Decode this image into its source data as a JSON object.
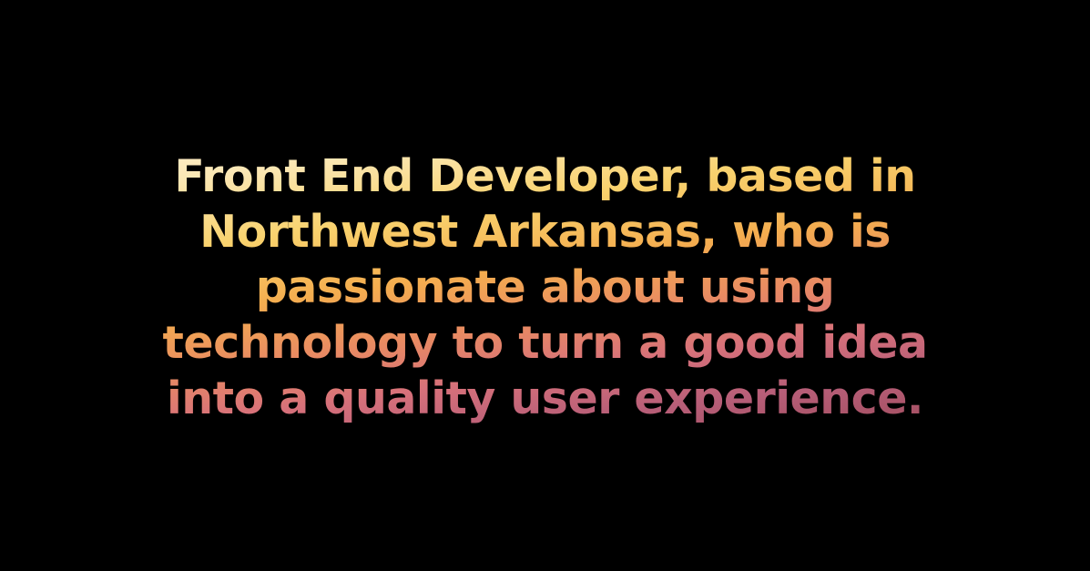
{
  "tagline": {
    "lines": [
      "Front End Developer, based in",
      "Northwest Arkansas, who is",
      "passionate about using",
      "technology to turn a good idea",
      "into a quality user experience."
    ]
  },
  "colors": {
    "background": "#000000",
    "gradient": [
      "#fff1d6",
      "#f9d26d",
      "#f4ad4f",
      "#e98b62",
      "#d7717a",
      "#9a4856"
    ]
  }
}
